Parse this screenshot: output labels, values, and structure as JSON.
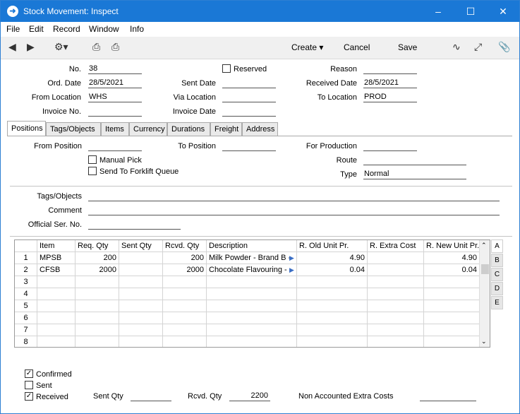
{
  "window": {
    "title": "Stock Movement: Inspect"
  },
  "menu": [
    "File",
    "Edit",
    "Record",
    "Window",
    "Info"
  ],
  "toolbar": {
    "create": "Create",
    "cancel": "Cancel",
    "save": "Save"
  },
  "header": {
    "no_label": "No.",
    "no": "38",
    "reserved_label": "Reserved",
    "reserved": false,
    "reason_label": "Reason",
    "reason": "",
    "orddate_label": "Ord. Date",
    "orddate": "28/5/2021",
    "sentdate_label": "Sent Date",
    "sentdate": "",
    "recdate_label": "Received Date",
    "recdate": "28/5/2021",
    "fromloc_label": "From Location",
    "fromloc": "WHS",
    "vialoc_label": "Via Location",
    "vialoc": "",
    "toloc_label": "To Location",
    "toloc": "PROD",
    "invno_label": "Invoice No.",
    "invno": "",
    "invdate_label": "Invoice Date",
    "invdate": ""
  },
  "tabs": [
    "Positions",
    "Tags/Objects",
    "Items",
    "Currency",
    "Durations",
    "Freight",
    "Address"
  ],
  "positions": {
    "frompos_label": "From Position",
    "frompos": "",
    "topos_label": "To Position",
    "topos": "",
    "forprod_label": "For Production",
    "forprod": "",
    "manualpick_label": "Manual Pick",
    "forklift_label": "Send To Forklift Queue",
    "route_label": "Route",
    "route": "",
    "type_label": "Type",
    "type": "Normal"
  },
  "details": {
    "tags_label": "Tags/Objects",
    "tags": "",
    "comment_label": "Comment",
    "comment": "",
    "offser_label": "Official Ser. No.",
    "offser": ""
  },
  "grid": {
    "columns": [
      "",
      "Item",
      "Req. Qty",
      "Sent Qty",
      "Rcvd. Qty",
      "Description",
      "R. Old Unit Pr.",
      "R. Extra Cost",
      "R. New Unit Pr."
    ],
    "rows": [
      [
        "1",
        "MPSB",
        "200",
        "",
        "200",
        "Milk Powder - Brand B -",
        "4.90",
        "",
        "4.90"
      ],
      [
        "2",
        "CFSB",
        "2000",
        "",
        "2000",
        "Chocolate Flavouring - B",
        "0.04",
        "",
        "0.04"
      ],
      [
        "3",
        "",
        "",
        "",
        "",
        "",
        "",
        "",
        ""
      ],
      [
        "4",
        "",
        "",
        "",
        "",
        "",
        "",
        "",
        ""
      ],
      [
        "5",
        "",
        "",
        "",
        "",
        "",
        "",
        "",
        ""
      ],
      [
        "6",
        "",
        "",
        "",
        "",
        "",
        "",
        "",
        ""
      ],
      [
        "7",
        "",
        "",
        "",
        "",
        "",
        "",
        "",
        ""
      ],
      [
        "8",
        "",
        "",
        "",
        "",
        "",
        "",
        "",
        ""
      ]
    ],
    "side_tabs": [
      "A",
      "B",
      "C",
      "D",
      "E"
    ]
  },
  "footer": {
    "confirmed_label": "Confirmed",
    "confirmed": true,
    "sent_label": "Sent",
    "sent": false,
    "received_label": "Received",
    "received": true,
    "sentqty_label": "Sent Qty",
    "sentqty": "",
    "rcvdqty_label": "Rcvd. Qty",
    "rcvdqty": "2200",
    "nonacc_label": "Non Accounted Extra Costs",
    "nonacc": ""
  }
}
